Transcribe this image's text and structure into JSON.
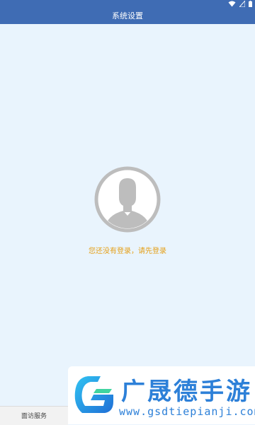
{
  "header": {
    "title": "系统设置"
  },
  "status_bar": {
    "icons": [
      "wifi-icon",
      "signal-icon",
      "battery-icon"
    ]
  },
  "main": {
    "avatar_icon": "user-avatar-icon",
    "login_prompt": "您还没有登录，请先登录"
  },
  "bottom_nav": {
    "items": [
      {
        "label": "面访服务"
      }
    ]
  },
  "watermark": {
    "brand": "广晟德手游",
    "url": "www.gsdtiepianji.com"
  },
  "colors": {
    "header_bg": "#3f6cb4",
    "page_bg": "#e9f4fd",
    "prompt_text": "#e5a019",
    "avatar_gray": "#bdbdbd"
  }
}
